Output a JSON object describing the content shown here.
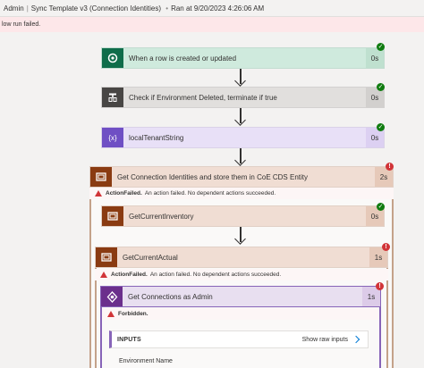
{
  "header": {
    "admin": "Admin",
    "flow_name": "Sync Template v3 (Connection Identities)",
    "bullet": "•",
    "ran_at": "Ran at 9/20/2023 4:26:06 AM"
  },
  "banner": {
    "text": "low run failed."
  },
  "steps": [
    {
      "title": "When a row is created or updated",
      "duration": "0s"
    },
    {
      "title": "Check if Environment Deleted, terminate if true",
      "duration": "0s"
    },
    {
      "title": "localTenantString",
      "duration": "0s"
    },
    {
      "title": "Get Connection Identities and store them in CoE CDS Entity",
      "duration": "2s"
    },
    {
      "title": "GetCurrentInventory",
      "duration": "0s"
    },
    {
      "title": "GetCurrentActual",
      "duration": "1s"
    },
    {
      "title": "Get Connections as Admin",
      "duration": "1s"
    }
  ],
  "errors": {
    "scope1": {
      "label": "ActionFailed.",
      "message": "An action failed. No dependent actions succeeded."
    },
    "scope2": {
      "label": "ActionFailed.",
      "message": "An action failed. No dependent actions succeeded."
    },
    "admin": {
      "label": "Forbidden.",
      "message": ""
    }
  },
  "inputs": {
    "label": "INPUTS",
    "show_raw": "Show raw inputs",
    "environment_name": "Environment Name"
  },
  "colors": {
    "dataverse_green": "#0f6d4a",
    "control_gray": "#484644",
    "variable_purple": "#6f4fc4",
    "scope_brown": "#8a3b12",
    "connector_purple": "#6b2f8c",
    "success": "#107c10",
    "error": "#d13438"
  },
  "icons": {
    "trigger": "dataverse-icon",
    "condition": "condition-icon",
    "variable": "variable-icon",
    "scope": "scope-icon",
    "admin": "powerplatform-admin-icon",
    "success": "checkmark-icon",
    "error": "exclamation-icon"
  }
}
